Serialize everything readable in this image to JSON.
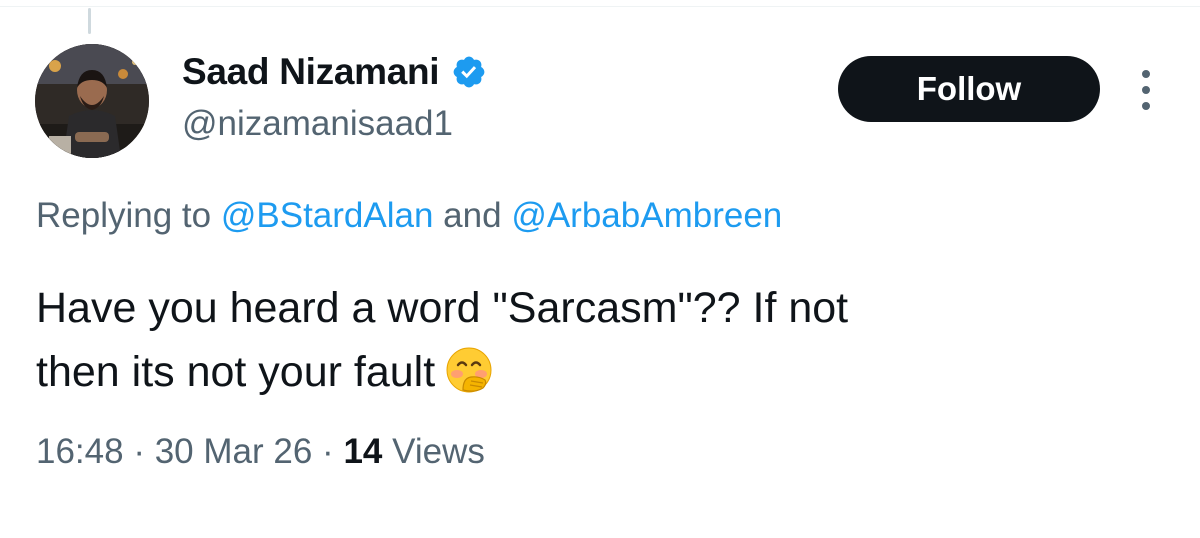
{
  "author": {
    "display_name": "Saad Nizamani",
    "handle": "@nizamanisaad1",
    "verified": true
  },
  "actions": {
    "follow_label": "Follow"
  },
  "reply_context": {
    "prefix": "Replying to",
    "mentions": [
      "@BStardAlan",
      "@ArbabAmbreen"
    ],
    "conjunction": "and"
  },
  "tweet": {
    "line1": "Have you heard a word \"Sarcasm\"?? If not",
    "line2": "then its not your fault",
    "emoji": "face-with-hand-over-mouth"
  },
  "meta": {
    "time": "16:48",
    "date": "30 Mar 26",
    "separator": "·",
    "views_count": "14",
    "views_label": "Views"
  },
  "colors": {
    "accent": "#1d9bf0",
    "text": "#0f1419",
    "muted": "#536471",
    "follow_bg": "#0f1419"
  },
  "icons": {
    "verified": "verified-badge-icon",
    "more": "more-options-icon"
  }
}
